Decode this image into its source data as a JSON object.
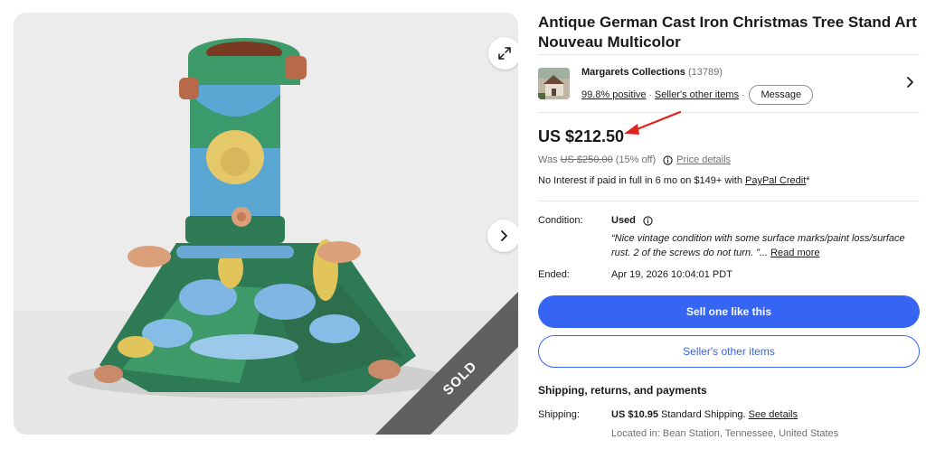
{
  "listing": {
    "title": "Antique German Cast Iron Christmas Tree Stand Art Nouveau Multicolor",
    "status_ribbon": "SOLD"
  },
  "seller": {
    "name": "Margarets Collections",
    "feedback_count": "(13789)",
    "positive": "99.8% positive",
    "other_items_link": "Seller's other items",
    "message_label": "Message"
  },
  "price": {
    "current": "US $212.50",
    "was_label": "Was",
    "was_price": "US $250.00",
    "discount": "(15% off)",
    "details_link": "Price details",
    "credit_text": "No Interest if paid in full in 6 mo on $149+ with ",
    "credit_link": "PayPal Credit",
    "credit_suffix": "*"
  },
  "condition": {
    "label": "Condition:",
    "value": "Used",
    "description": "“Nice vintage condition with some surface marks/paint loss/surface rust. 2 of the screws do not turn. ”...",
    "read_more": "Read more"
  },
  "ended": {
    "label": "Ended:",
    "value": "Apr 19, 2026 10:04:01 PDT"
  },
  "actions": {
    "sell_like": "Sell one like this",
    "seller_other_items": "Seller's other items"
  },
  "shipping": {
    "heading": "Shipping, returns, and payments",
    "label": "Shipping:",
    "cost": "US $10.95",
    "method": " Standard Shipping. ",
    "details_link": "See details",
    "location": "Located in: Bean Station, Tennessee, United States"
  },
  "colors": {
    "accent_blue": "#3665f3",
    "annotation_red": "#e0231c"
  }
}
